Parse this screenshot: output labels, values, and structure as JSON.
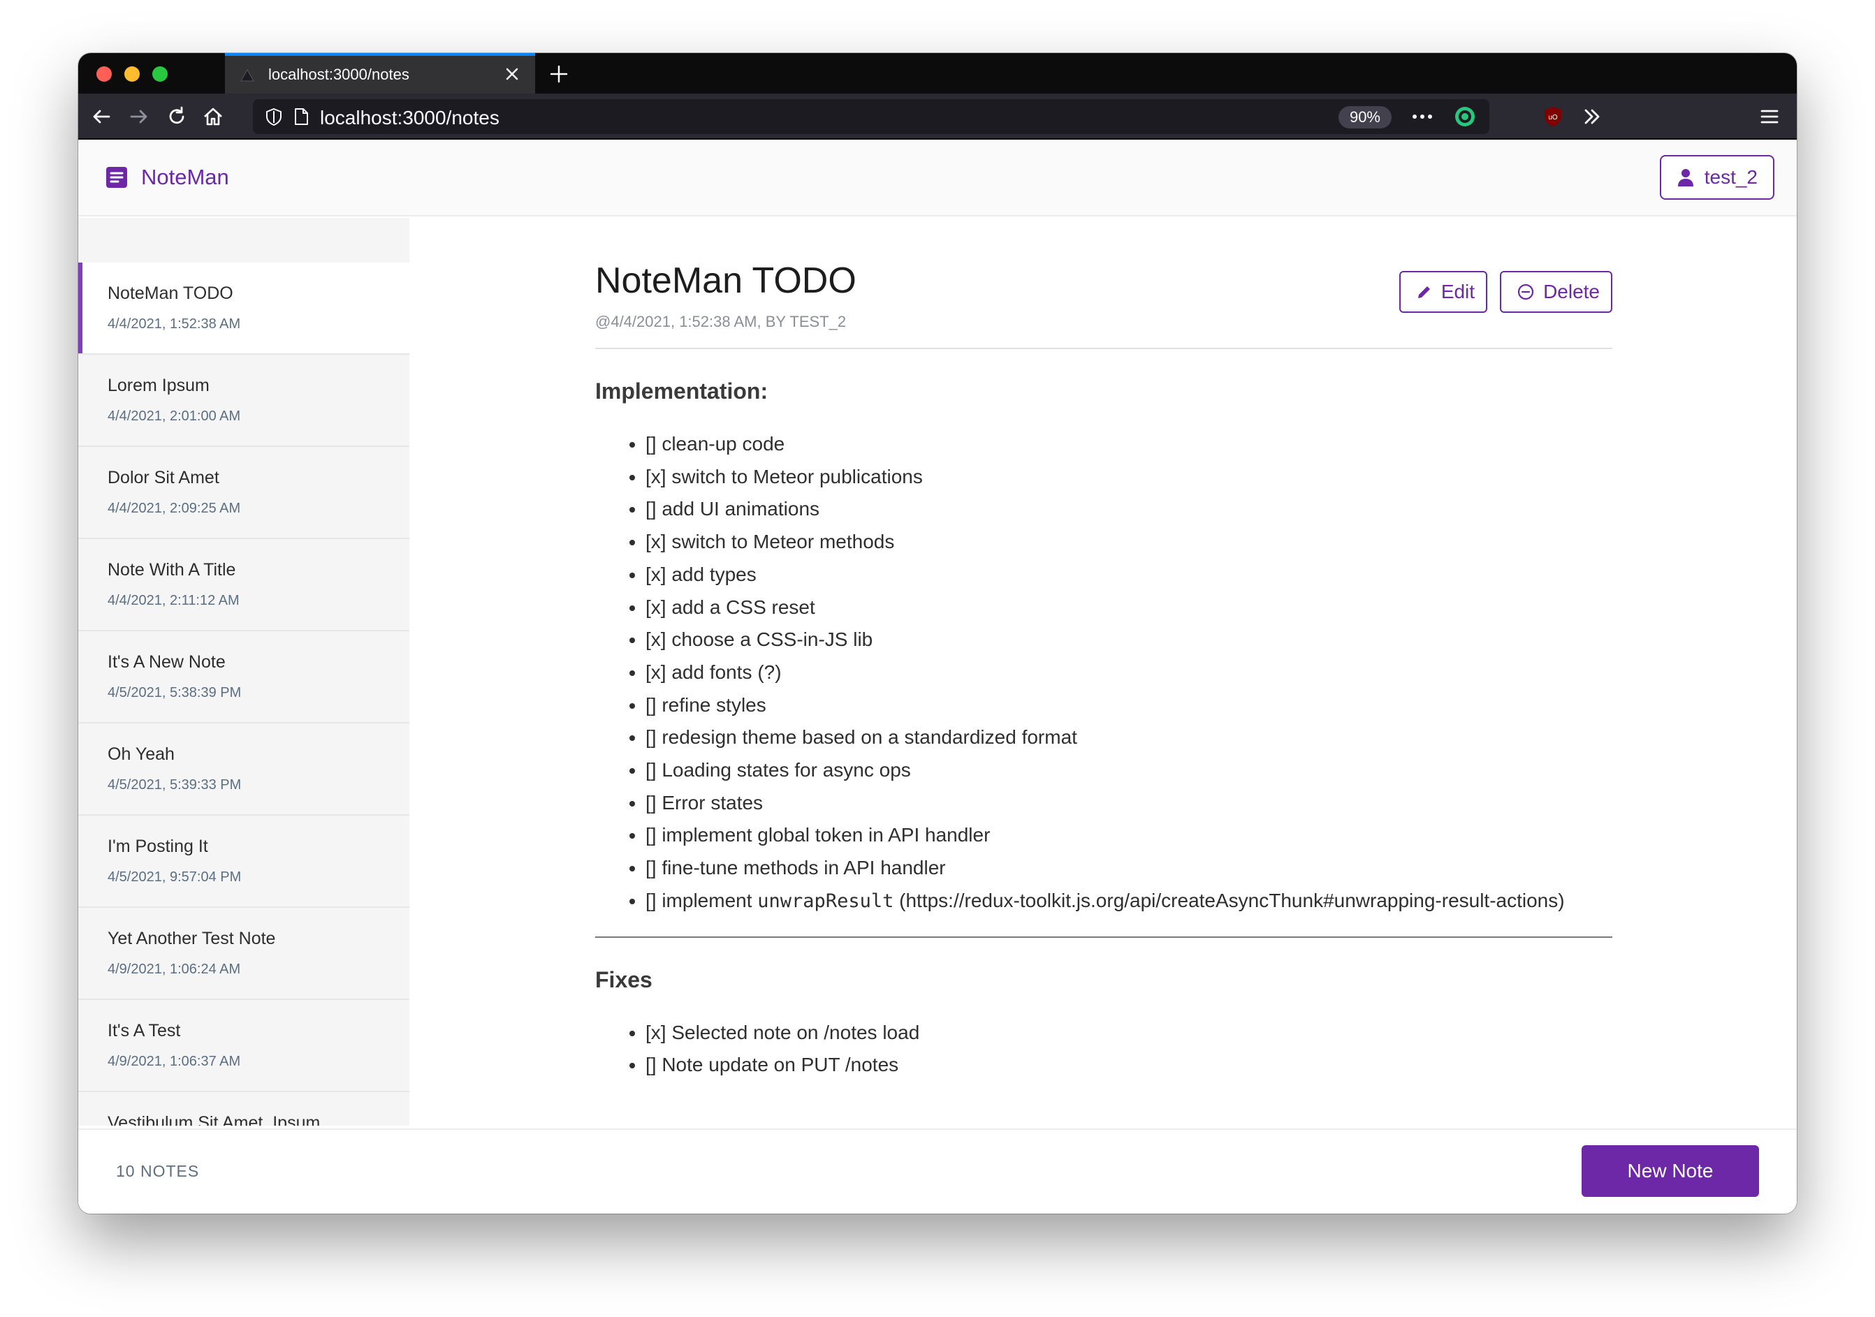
{
  "browser": {
    "tab_title": "localhost:3000/notes",
    "url": "localhost:3000/notes",
    "zoom": "90%"
  },
  "app": {
    "brand": "NoteMan",
    "user": "test_2",
    "accent": "#6d28a8"
  },
  "sidebar": {
    "notes": [
      {
        "title": "NoteMan TODO",
        "date": "4/4/2021, 1:52:38 AM"
      },
      {
        "title": "Lorem Ipsum",
        "date": "4/4/2021, 2:01:00 AM"
      },
      {
        "title": "Dolor Sit Amet",
        "date": "4/4/2021, 2:09:25 AM"
      },
      {
        "title": "Note With A Title",
        "date": "4/4/2021, 2:11:12 AM"
      },
      {
        "title": "It's A New Note",
        "date": "4/5/2021, 5:38:39 PM"
      },
      {
        "title": "Oh Yeah",
        "date": "4/5/2021, 5:39:33 PM"
      },
      {
        "title": "I'm Posting It",
        "date": "4/5/2021, 9:57:04 PM"
      },
      {
        "title": "Yet Another Test Note",
        "date": "4/9/2021, 1:06:24 AM"
      },
      {
        "title": "It's A Test",
        "date": "4/9/2021, 1:06:37 AM"
      },
      {
        "title": "Vestibulum Sit Amet, Ipsum",
        "date": ""
      }
    ]
  },
  "note": {
    "title": "NoteMan TODO",
    "meta": "@4/4/2021, 1:52:38 AM, BY TEST_2",
    "edit_label": "Edit",
    "delete_label": "Delete",
    "sections": [
      {
        "heading": "Implementation:",
        "items": [
          "[] clean-up code",
          "[x] switch to Meteor publications",
          "[] add UI animations",
          "[x] switch to Meteor methods",
          "[x] add types",
          "[x] add a CSS reset",
          "[x] choose a CSS-in-JS lib",
          "[x] add fonts (?)",
          "[] refine styles",
          "[] redesign theme based on a standardized format",
          "[] Loading states for async ops",
          "[] Error states",
          "[] implement global token in API handler",
          "[] fine-tune methods in API handler"
        ],
        "last_item": {
          "prefix": "[] implement ",
          "code": "unwrapResult",
          "suffix": " (https://redux-toolkit.js.org/api/createAsyncThunk#unwrapping-result-actions)"
        }
      },
      {
        "heading": "Fixes",
        "items": [
          "[x] Selected note on /notes load",
          "[] Note update on PUT /notes"
        ]
      }
    ]
  },
  "footer": {
    "count": "10 NOTES",
    "new_note_label": "New Note"
  }
}
